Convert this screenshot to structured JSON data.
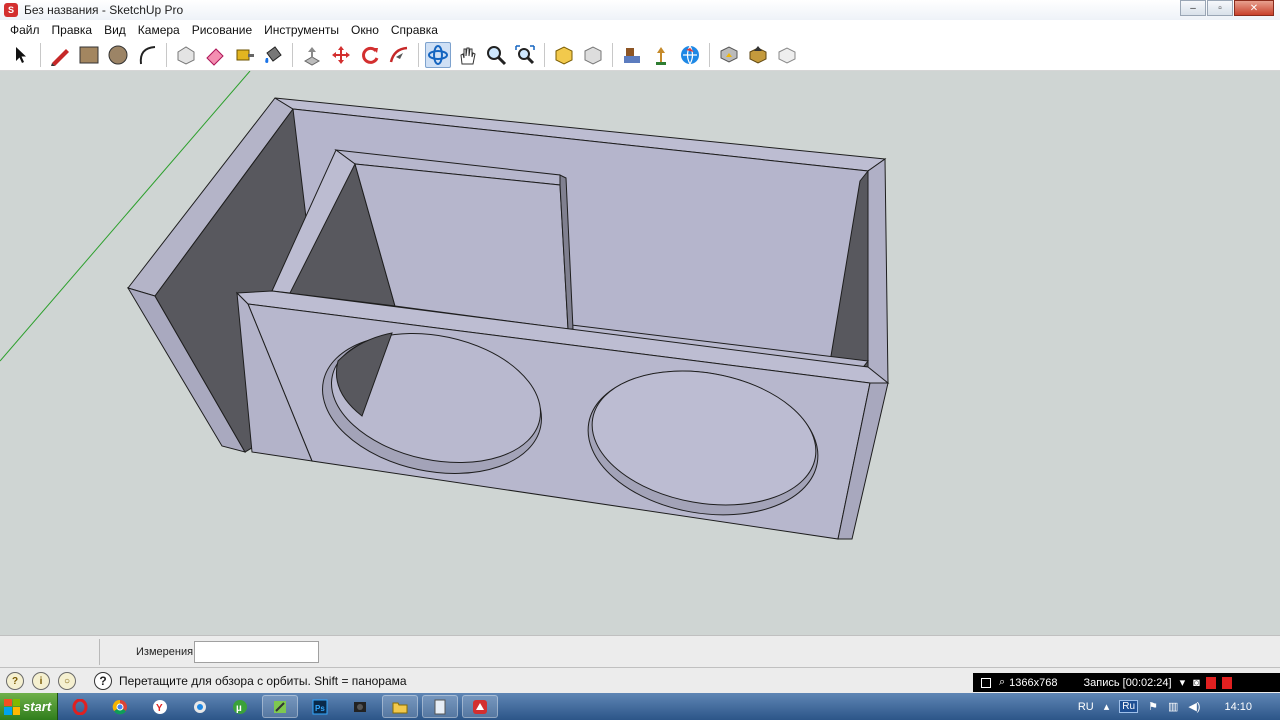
{
  "window": {
    "title": "Без названия - SketchUp Pro",
    "minimize": "–",
    "maximize": "▫",
    "close": "✕"
  },
  "menu": [
    "Файл",
    "Правка",
    "Вид",
    "Камера",
    "Рисование",
    "Инструменты",
    "Окно",
    "Справка"
  ],
  "toolbar": {
    "tools": [
      "select-tool",
      "line-tool",
      "rectangle-tool",
      "circle-tool",
      "arc-tool",
      "make-component-tool",
      "eraser-tool",
      "tape-measure-tool",
      "paint-bucket-tool",
      "push-pull-tool",
      "move-tool",
      "rotate-tool",
      "follow-me-tool",
      "orbit-tool",
      "pan-tool",
      "zoom-tool",
      "zoom-extents-tool",
      "get-models-tool",
      "share-model-tool",
      "components-tool",
      "extension-tool",
      "3d-warehouse-tool",
      "import-tool",
      "export-tool",
      "preview-tool"
    ],
    "active_tool": "orbit-tool"
  },
  "measurements": {
    "label": "Измерения",
    "value": ""
  },
  "status": {
    "hint": "Перетащите для обзора с орбиты.  Shift = панорама"
  },
  "recorder": {
    "resolution": "1366x768",
    "recording": "Запись [00:02:24]"
  },
  "taskbar": {
    "start_label": "start",
    "apps": [
      "opera",
      "chrome",
      "yandex",
      "agent",
      "utorrent",
      "notepad",
      "photoshop",
      "bandicam",
      "explorer",
      "calculator",
      "sketchup"
    ],
    "tray_lang": "RU",
    "tray_lang_badge": "Ru",
    "clock": "14:10"
  },
  "model": {
    "colors": {
      "face": "#b6b6cd",
      "shadow": "#58585e",
      "edge": "#1e1e1e",
      "background": "#cfd5d3",
      "axis": "#2da02d"
    }
  }
}
